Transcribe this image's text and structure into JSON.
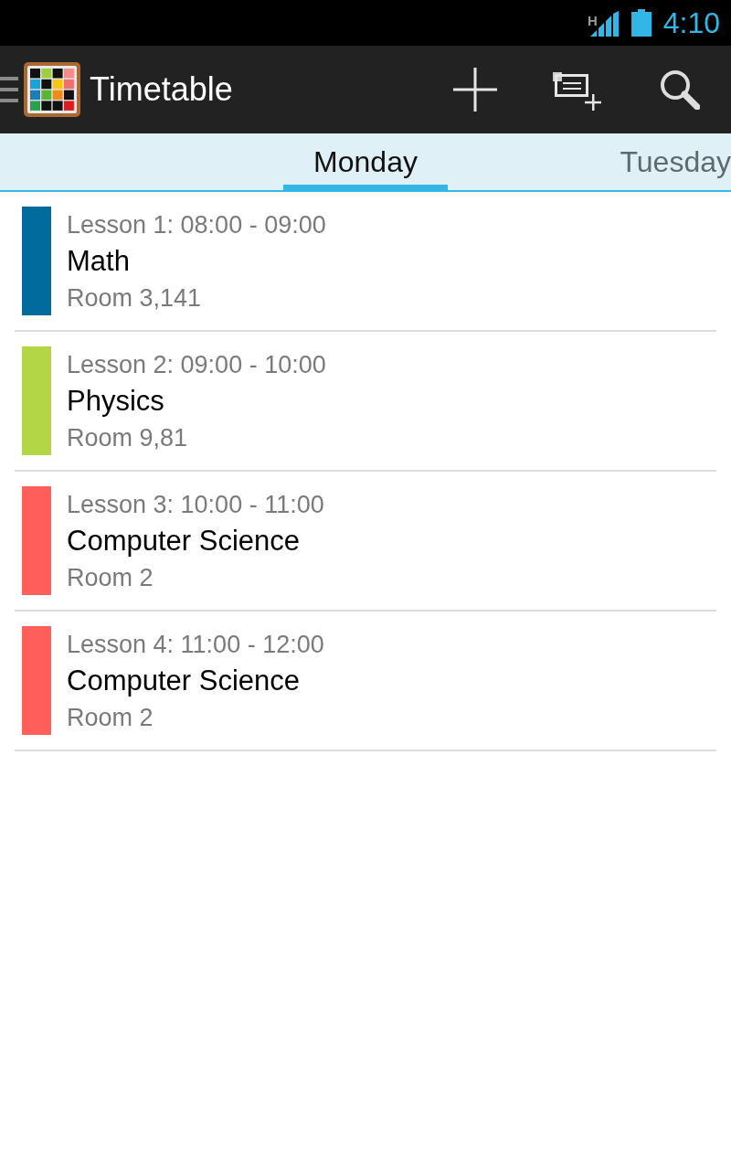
{
  "status_bar": {
    "network_type": "H",
    "time": "4:10"
  },
  "action_bar": {
    "title": "Timetable"
  },
  "tabs": [
    {
      "label": "Monday",
      "selected": true
    },
    {
      "label": "Tuesday",
      "selected": false
    }
  ],
  "lessons": [
    {
      "time": "Lesson 1: 08:00 - 09:00",
      "subject": "Math",
      "room": "Room 3,141",
      "color": "#006b9c"
    },
    {
      "time": "Lesson 2: 09:00 - 10:00",
      "subject": "Physics",
      "room": "Room 9,81",
      "color": "#b3d647"
    },
    {
      "time": "Lesson 3: 10:00 - 11:00",
      "subject": "Computer Science",
      "room": "Room 2",
      "color": "#ff5e5a"
    },
    {
      "time": "Lesson 4: 11:00 - 12:00",
      "subject": "Computer Science",
      "room": "Room 2",
      "color": "#ff5e5a"
    }
  ]
}
